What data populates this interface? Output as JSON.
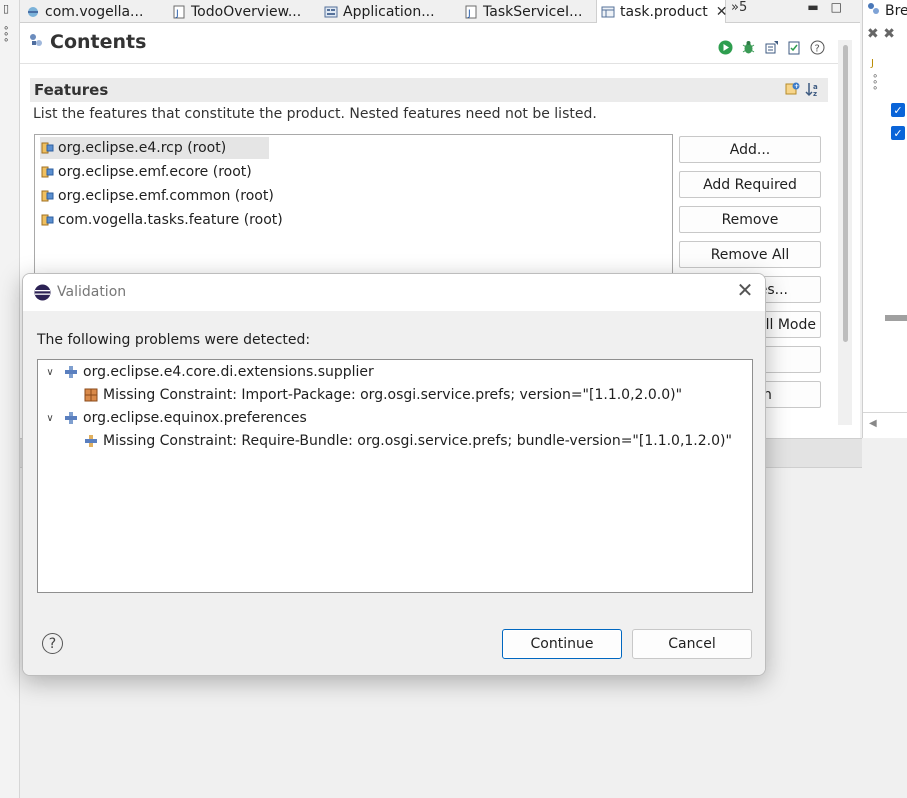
{
  "tabs": [
    {
      "label": "com.vogella...",
      "icon": "java-file-icon"
    },
    {
      "label": "TodoOverview...",
      "icon": "java-file-icon"
    },
    {
      "label": "Application...",
      "icon": "app-model-icon"
    },
    {
      "label": "TaskServiceI...",
      "icon": "java-file-icon"
    },
    {
      "label": "task.product",
      "icon": "product-file-icon",
      "active": true
    }
  ],
  "overflow_label": "»5",
  "editor": {
    "title": "Contents",
    "section_title": "Features",
    "section_desc": "List the features that constitute the product.  Nested features need not be listed.",
    "features": [
      "org.eclipse.e4.rcp (root)",
      "org.eclipse.emf.ecore (root)",
      "org.eclipse.emf.common (root)",
      "com.vogella.tasks.feature (root)"
    ],
    "buttons": {
      "add": "Add...",
      "add_required": "Add Required",
      "remove": "Remove",
      "remove_all": "Remove All",
      "properties_partial": "es...",
      "mode_partial": "ll Mode",
      "partial_7": "n"
    }
  },
  "right_panel": {
    "title": "Bre"
  },
  "dialog": {
    "title": "Validation",
    "message": "The following problems were detected:",
    "problems": [
      {
        "bundle": "org.eclipse.e4.core.di.extensions.supplier",
        "constraint": "Missing Constraint: Import-Package: org.osgi.service.prefs; version=\"[1.1.0,2.0.0)\""
      },
      {
        "bundle": "org.eclipse.equinox.preferences",
        "constraint": "Missing Constraint: Require-Bundle: org.osgi.service.prefs; bundle-version=\"[1.1.0,1.2.0)\""
      }
    ],
    "continue_label": "Continue",
    "cancel_label": "Cancel"
  },
  "colors": {
    "accent": "#0067c0",
    "checkbox": "#0a64d8"
  }
}
